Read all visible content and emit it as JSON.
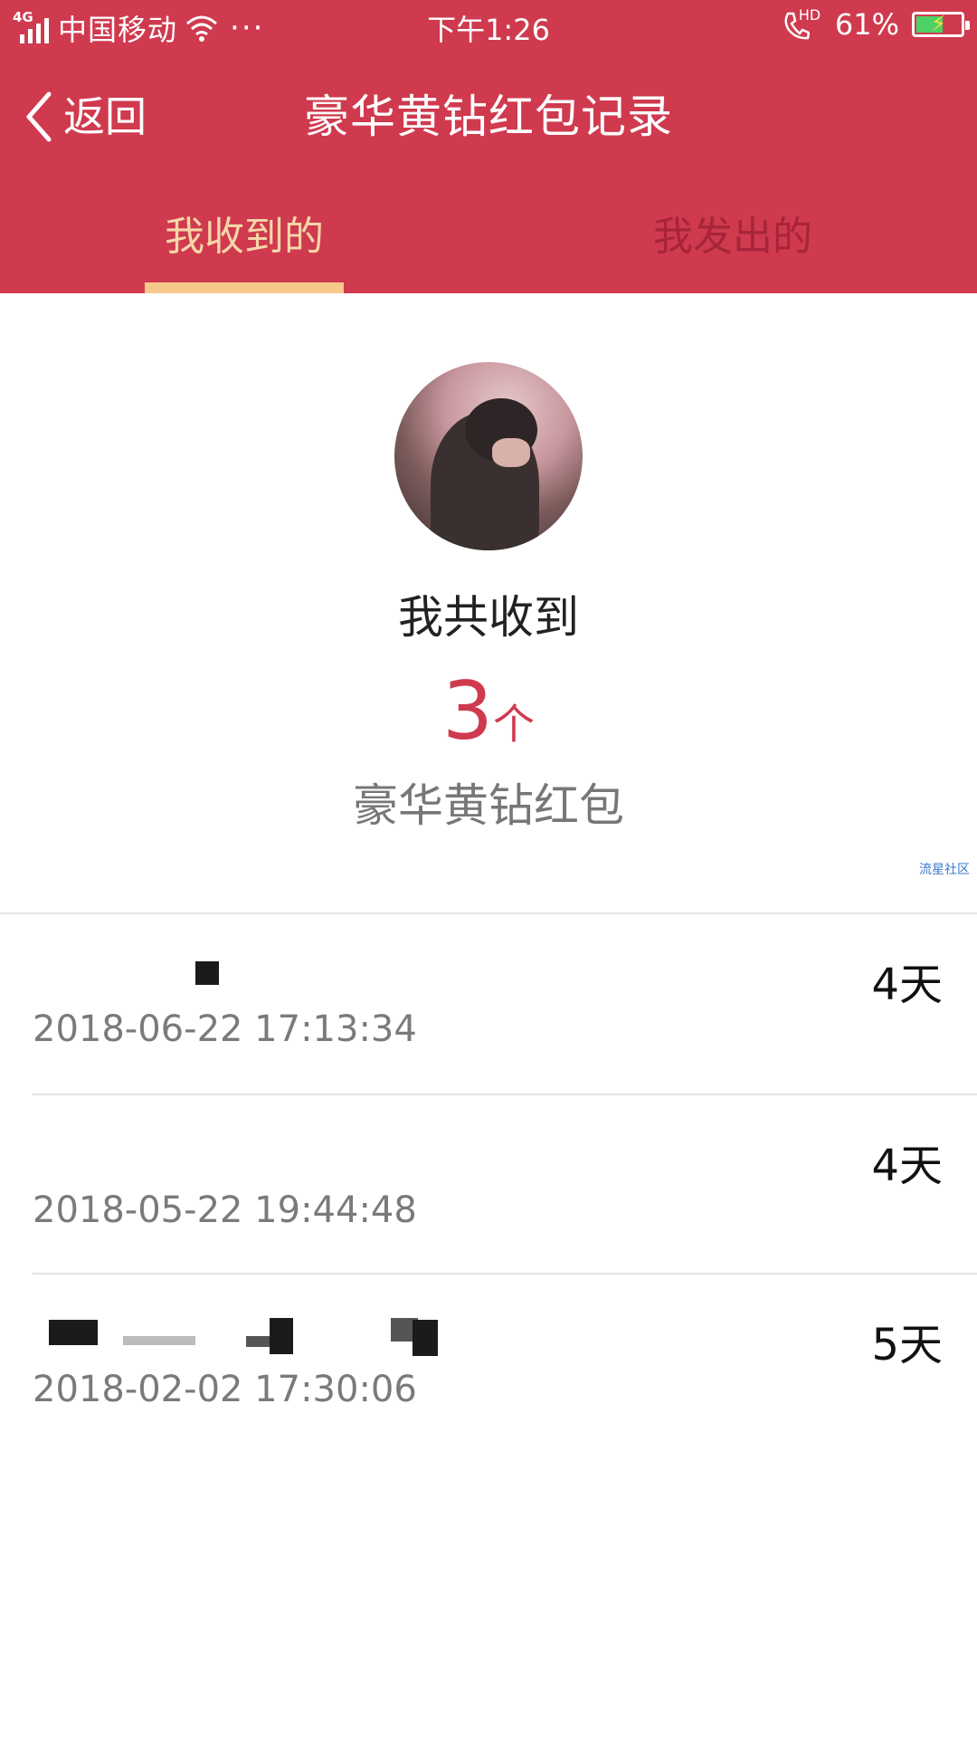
{
  "status_bar": {
    "network": "4G",
    "carrier": "中国移动",
    "dots": "···",
    "time": "下午1:26",
    "call_label": "HD",
    "battery_percent": "61%",
    "battery_level": 0.61
  },
  "nav": {
    "back_label": "返回",
    "title": "豪华黄钻红包记录"
  },
  "tabs": {
    "received": "我收到的",
    "sent": "我发出的",
    "active": "received"
  },
  "summary": {
    "label": "我共收到",
    "count": "3",
    "unit": "个",
    "subtitle": "豪华黄钻红包",
    "watermark": "流星社区"
  },
  "records": [
    {
      "date": "2018-06-22 17:13:34",
      "days": "4天"
    },
    {
      "date": "2018-05-22 19:44:48",
      "days": "4天"
    },
    {
      "date": "2018-02-02 17:30:06",
      "days": "5天"
    }
  ],
  "colors": {
    "header": "#cf3a4f",
    "tab_active": "#f6d6a8",
    "tab_inactive": "#a7243a",
    "indicator": "#f6c98a",
    "accent_count": "#cf3a4f"
  }
}
